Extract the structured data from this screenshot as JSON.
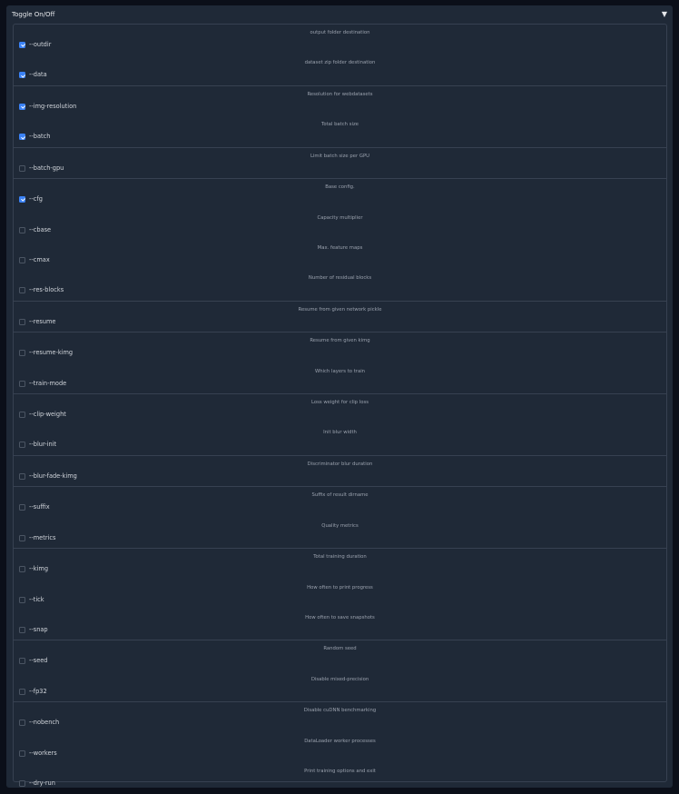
{
  "panel": {
    "title": "Toggle On/Off",
    "collapse_icon": "triangle-down-icon",
    "collapse_glyph": "▼"
  },
  "colors": {
    "background": "#0b0f19",
    "panel": "#1f2937",
    "border": "#374151",
    "checkbox_checked": "#3b82f6"
  },
  "groups": [
    [
      {
        "name": "--outdir",
        "description": "output folder destination",
        "checked": true
      },
      {
        "name": "--data",
        "description": "dataset zip folder destination",
        "checked": true
      }
    ],
    [
      {
        "name": "--img-resolution",
        "description": "Resolution for webdatasets",
        "checked": true
      },
      {
        "name": "--batch",
        "description": "Total batch size",
        "checked": true
      }
    ],
    [
      {
        "name": "--batch-gpu",
        "description": "Limit batch size per GPU",
        "checked": false
      }
    ],
    [
      {
        "name": "--cfg",
        "description": "Base config.",
        "checked": true
      },
      {
        "name": "--cbase",
        "description": "Capacity multiplier",
        "checked": false
      },
      {
        "name": "--cmax",
        "description": "Max. feature maps",
        "checked": false
      },
      {
        "name": "--res-blocks",
        "description": "Number of residual blocks",
        "checked": false
      }
    ],
    [
      {
        "name": "--resume",
        "description": "Resume from given network pickle",
        "checked": false
      }
    ],
    [
      {
        "name": "--resume-kimg",
        "description": "Resume from given kimg",
        "checked": false
      },
      {
        "name": "--train-mode",
        "description": "Which layers to train",
        "checked": false
      }
    ],
    [
      {
        "name": "--clip-weight",
        "description": "Loss weight for clip loss",
        "checked": false
      },
      {
        "name": "--blur-init",
        "description": "Init blur width",
        "checked": false
      }
    ],
    [
      {
        "name": "--blur-fade-kimg",
        "description": "Discriminator blur duration",
        "checked": false
      }
    ],
    [
      {
        "name": "--suffix",
        "description": "Suffix of result dirname",
        "checked": false
      },
      {
        "name": "--metrics",
        "description": "Quality metrics",
        "checked": false
      }
    ],
    [
      {
        "name": "--kimg",
        "description": "Total training duration",
        "checked": false
      },
      {
        "name": "--tick",
        "description": "How often to print progress",
        "checked": false
      },
      {
        "name": "--snap",
        "description": "How often to save snapshots",
        "checked": false
      }
    ],
    [
      {
        "name": "--seed",
        "description": "Random seed",
        "checked": false
      },
      {
        "name": "--fp32",
        "description": "Disable mixed-precision",
        "checked": false
      }
    ],
    [
      {
        "name": "--nobench",
        "description": "Disable cuDNN benchmarking",
        "checked": false
      },
      {
        "name": "--workers",
        "description": "DataLoader worker processes",
        "checked": false
      },
      {
        "name": "--dry-run",
        "description": "Print training options and exit",
        "checked": false
      }
    ]
  ]
}
